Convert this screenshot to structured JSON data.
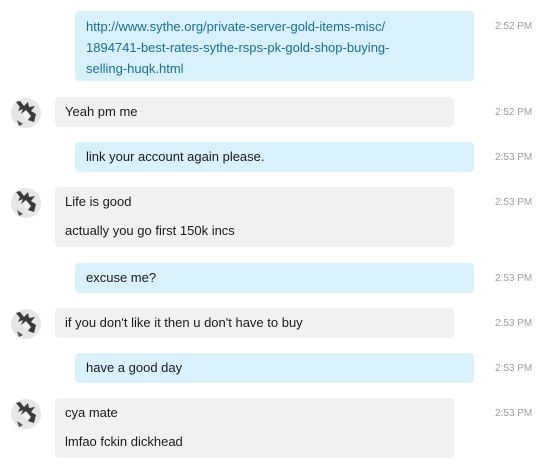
{
  "messages": [
    {
      "direction": "outgoing",
      "link_lines": [
        "http://www.sythe.org/private-server-gold-items-misc/",
        "1894741-best-rates-sythe-rsps-pk-gold-shop-buying-",
        "selling-huqk.html"
      ],
      "time": "2:52 PM"
    },
    {
      "direction": "incoming",
      "lines": [
        "Yeah pm me"
      ],
      "time": "2:52 PM"
    },
    {
      "direction": "outgoing",
      "lines": [
        "link your account again please."
      ],
      "time": "2:53 PM"
    },
    {
      "direction": "incoming",
      "lines": [
        "Life is good",
        "actually you go first 150k incs"
      ],
      "time": "2:53 PM"
    },
    {
      "direction": "outgoing",
      "lines": [
        "excuse me?"
      ],
      "time": "2:53 PM"
    },
    {
      "direction": "incoming",
      "lines": [
        "if you don't like it then u don't have to buy"
      ],
      "time": "2:53 PM"
    },
    {
      "direction": "outgoing",
      "lines": [
        "have a good day"
      ],
      "time": "2:53 PM"
    },
    {
      "direction": "incoming",
      "lines": [
        "cya mate",
        "lmfao fckin dickhead"
      ],
      "time": "2:53 PM"
    }
  ],
  "colors": {
    "outgoing_bubble": "#d9f1fb",
    "incoming_bubble": "#f1f1f2",
    "link": "#15719b",
    "timestamp": "#9aa1a7"
  }
}
